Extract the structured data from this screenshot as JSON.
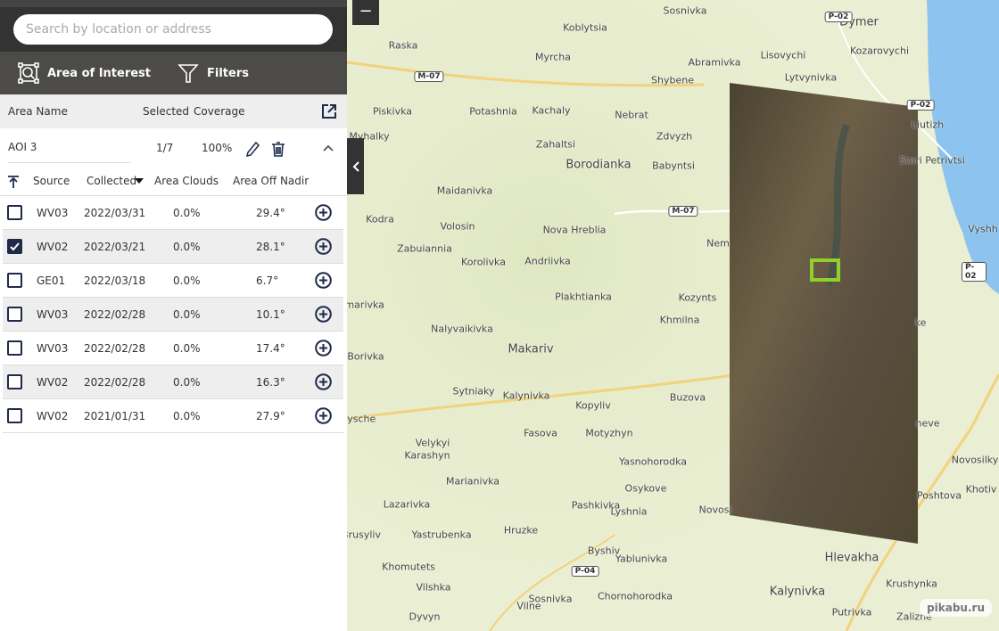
{
  "search": {
    "placeholder": "Search by location or address"
  },
  "tools": {
    "aoi": "Area of Interest",
    "filters": "Filters"
  },
  "aoi_header": {
    "name": "Area Name",
    "selected": "Selected",
    "coverage": "Coverage"
  },
  "aoi": {
    "name": "AOI 3",
    "selected": "1/7",
    "coverage": "100%"
  },
  "table_header": {
    "source": "Source",
    "collected": "Collected",
    "clouds": "Area Clouds",
    "nadir": "Area Off Nadir"
  },
  "rows": [
    {
      "source": "WV03",
      "collected": "2022/03/31",
      "clouds": "0.0%",
      "nadir": "29.4°",
      "checked": false
    },
    {
      "source": "WV02",
      "collected": "2022/03/21",
      "clouds": "0.0%",
      "nadir": "28.1°",
      "checked": true
    },
    {
      "source": "GE01",
      "collected": "2022/03/18",
      "clouds": "0.0%",
      "nadir": "6.7°",
      "checked": false
    },
    {
      "source": "WV03",
      "collected": "2022/02/28",
      "clouds": "0.0%",
      "nadir": "10.1°",
      "checked": false
    },
    {
      "source": "WV03",
      "collected": "2022/02/28",
      "clouds": "0.0%",
      "nadir": "17.4°",
      "checked": false
    },
    {
      "source": "WV02",
      "collected": "2022/02/28",
      "clouds": "0.0%",
      "nadir": "16.3°",
      "checked": false
    },
    {
      "source": "WV02",
      "collected": "2021/01/31",
      "clouds": "0.0%",
      "nadir": "27.9°",
      "checked": false
    }
  ],
  "map": {
    "zoom_out": "−",
    "places": [
      "Sosnivka",
      "Dymer",
      "Koblytsia",
      "Raska",
      "Myrcha",
      "Lisovychi",
      "Kozarovychi",
      "Abramivka",
      "Shybene",
      "Lytvynivka",
      "Piskivka",
      "Potashnia",
      "Kachaly",
      "Nebrat",
      "Liutizh",
      "Myhalky",
      "Zahaltsi",
      "Zdvyzh",
      "Stari Petrivtsi",
      "Borodianka",
      "Babyntsi",
      "Maidanivka",
      "Kodra",
      "Volosin",
      "Nova Hreblia",
      "Vyshh",
      "Zabuiannia",
      "Korolivka",
      "Andriivka",
      "Nem",
      "Plakhtianka",
      "Kozynts",
      "Komarivka",
      "Khmilna",
      "Nalyvaikivka",
      "Makariv",
      "ke",
      "Borivka",
      "Sytniaky",
      "Kalynivka",
      "Buzova",
      "Kopyliv",
      "Stavysche",
      "Fasova",
      "Motyzhyn",
      "neve",
      "Velykyi",
      "Karashyn",
      "Novosilky",
      "Yasnohorodka",
      "Marianivka",
      "Khotiv",
      "Osykove",
      "Novosi",
      "Poshtova",
      "Lazarivka",
      "Pashkivka",
      "Lyshnia",
      "Brusyliv",
      "Hruzke",
      "Yastrubenka",
      "Byshiv",
      "Yablunivka",
      "Hlevakha",
      "Khomutets",
      "Vilshka",
      "Chornohorodka",
      "Kalynivka",
      "Krushynka",
      "Sosnivka",
      "Vilne",
      "Dyvyn",
      "Putrivka",
      "Zalizne"
    ],
    "roads": [
      "M-07",
      "P-02",
      "P-02",
      "M-07",
      "P-02",
      "P-04"
    ],
    "watermark": "pikabu.ru"
  },
  "colors": {
    "accent": "#1f2a4a",
    "aoi_box": "#8fd12a",
    "water": "#8cc4ef"
  }
}
